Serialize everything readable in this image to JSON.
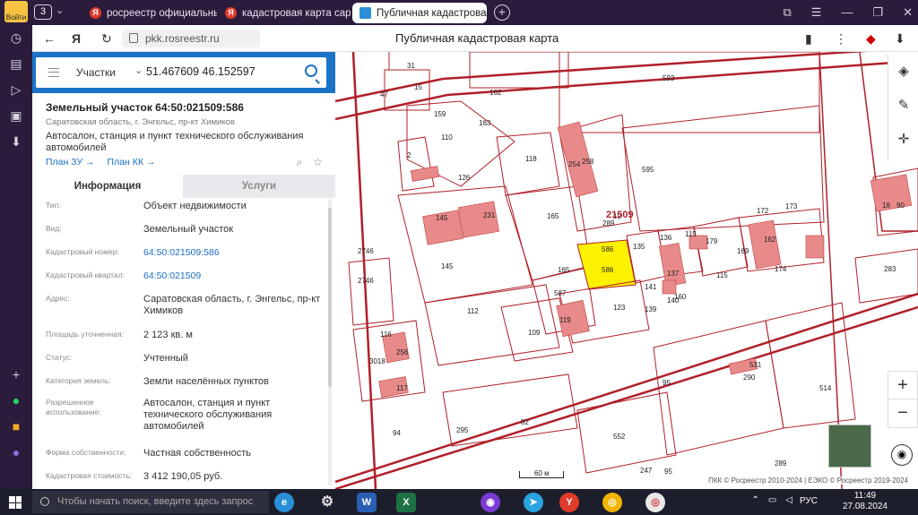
{
  "browser": {
    "profile_label": "Войти",
    "tab_count": "3",
    "tabs": [
      {
        "title": "росреестр официальный"
      },
      {
        "title": "кадастровая карта сарат"
      },
      {
        "title": "Публичная кадастровая"
      }
    ],
    "url": "pkk.rosreestr.ru",
    "page_title": "Публичная кадастровая карта"
  },
  "search": {
    "layer": "Участки",
    "query": "51.467609 46.152597"
  },
  "object": {
    "title": "Земельный участок 64:50:021509:586",
    "address_short": "Саратовская область, г. Энгельс, пр-кт Химиков",
    "description": "Автосалон, станция и пункт технического обслуживания автомобилей",
    "link_plan_zu": "План ЗУ →",
    "link_plan_kk": "План КК →"
  },
  "tabs": {
    "info": "Информация",
    "services": "Услуги"
  },
  "info": [
    {
      "k": "Тип:",
      "v": "Объект недвижимости"
    },
    {
      "k": "Вид:",
      "v": "Земельный участок"
    },
    {
      "k": "Кадастровый номер:",
      "v": "64:50:021509:586"
    },
    {
      "k": "Кадастровый квартал:",
      "v": "64:50:021509"
    },
    {
      "k": "Адрес:",
      "v": "Саратовская область, г. Энгельс, пр-кт Химиков"
    },
    {
      "k": "Площадь уточненная:",
      "v": "2 123 кв. м"
    },
    {
      "k": "Статус:",
      "v": "Учтенный"
    },
    {
      "k": "Категория земель:",
      "v": "Земли населённых пунктов"
    },
    {
      "k": "Разрешенное использование:",
      "v": "Автосалон, станция и пункт технического обслуживания автомобилей"
    },
    {
      "k": "Форма собственности:",
      "v": "Частная собственность"
    },
    {
      "k": "Кадастровая стоимость:",
      "v": "3 412 190,05 руб."
    }
  ],
  "map": {
    "scale_label": "60 м",
    "copyright": "ПКК © Росреестр 2010-2024 | ЕЭКО © Росреестр 2019-2024",
    "quarter_label": "21509",
    "parcel_labels": [
      "31",
      "47",
      "15",
      "162",
      "593",
      "159",
      "163",
      "110",
      "2",
      "118",
      "254",
      "258",
      "595",
      "126",
      "145",
      "231",
      "165",
      "289",
      "10",
      "172",
      "173",
      "18",
      "90",
      "2746",
      "145",
      "586",
      "586",
      "135",
      "136",
      "115",
      "179",
      "169",
      "162",
      "174",
      "283",
      "165",
      "587",
      "141",
      "137",
      "160",
      "115",
      "2746",
      "112",
      "119",
      "123",
      "139",
      "140",
      "116",
      "256",
      "109",
      "3018",
      "117",
      "531",
      "290",
      "95",
      "514",
      "82",
      "295",
      "552",
      "94",
      "247",
      "289",
      "95"
    ],
    "zoom_in": "+",
    "zoom_out": "−"
  },
  "taskbar": {
    "search_placeholder": "Чтобы начать поиск, введите здесь запрос",
    "lang": "РУС",
    "time": "11:49",
    "date": "27.08.2024"
  },
  "colors": {
    "accent": "#1a73c7",
    "parcel_line": "#b0202a",
    "building_fill": "#e88a8a",
    "selected_parcel": "#fff200"
  }
}
